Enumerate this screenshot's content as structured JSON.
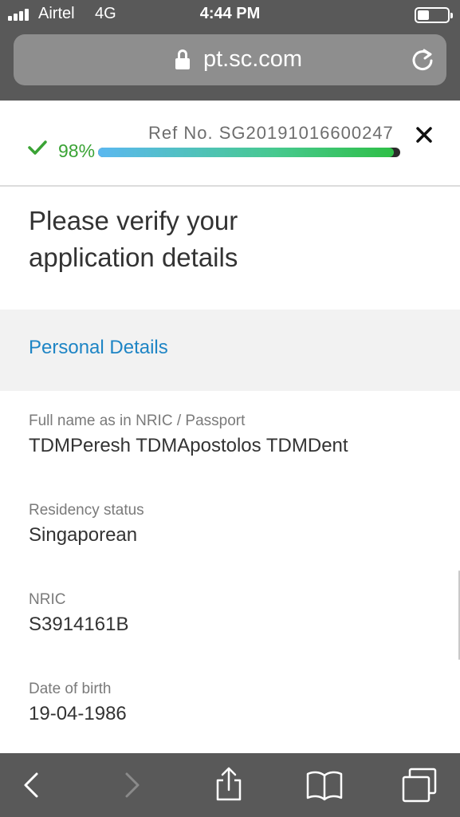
{
  "status_bar": {
    "carrier": "Airtel",
    "network": "4G",
    "time": "4:44 PM"
  },
  "url_bar": {
    "url": "pt.sc.com",
    "lock_icon": "lock-icon",
    "reload_icon": "reload-icon"
  },
  "progress": {
    "percent_label": "98%",
    "percent_value": 0.98,
    "reference": "Ref No. SG20191016600247",
    "colors": {
      "text": "#3aa335",
      "bar_start": "#5bb8f0",
      "bar_end": "#2fbf47",
      "track": "#2b2b2b"
    }
  },
  "page": {
    "title_line1": "Please verify your",
    "title_line2": "application details",
    "section_title": "Personal Details"
  },
  "fields": [
    {
      "label": "Full name as in NRIC / Passport",
      "value": "TDMPeresh TDMApostolos TDMDent"
    },
    {
      "label": "Residency status",
      "value": "Singaporean"
    },
    {
      "label": "NRIC",
      "value": "S3914161B"
    },
    {
      "label": "Date of birth",
      "value": "19-04-1986"
    }
  ],
  "toolbar": {
    "icons": [
      "back-icon",
      "forward-icon",
      "share-icon",
      "bookmarks-icon",
      "tabs-icon"
    ]
  },
  "colors": {
    "chrome": "#595959",
    "accent": "#1e85c5",
    "text": "#333333",
    "label": "#7a7a7a"
  }
}
